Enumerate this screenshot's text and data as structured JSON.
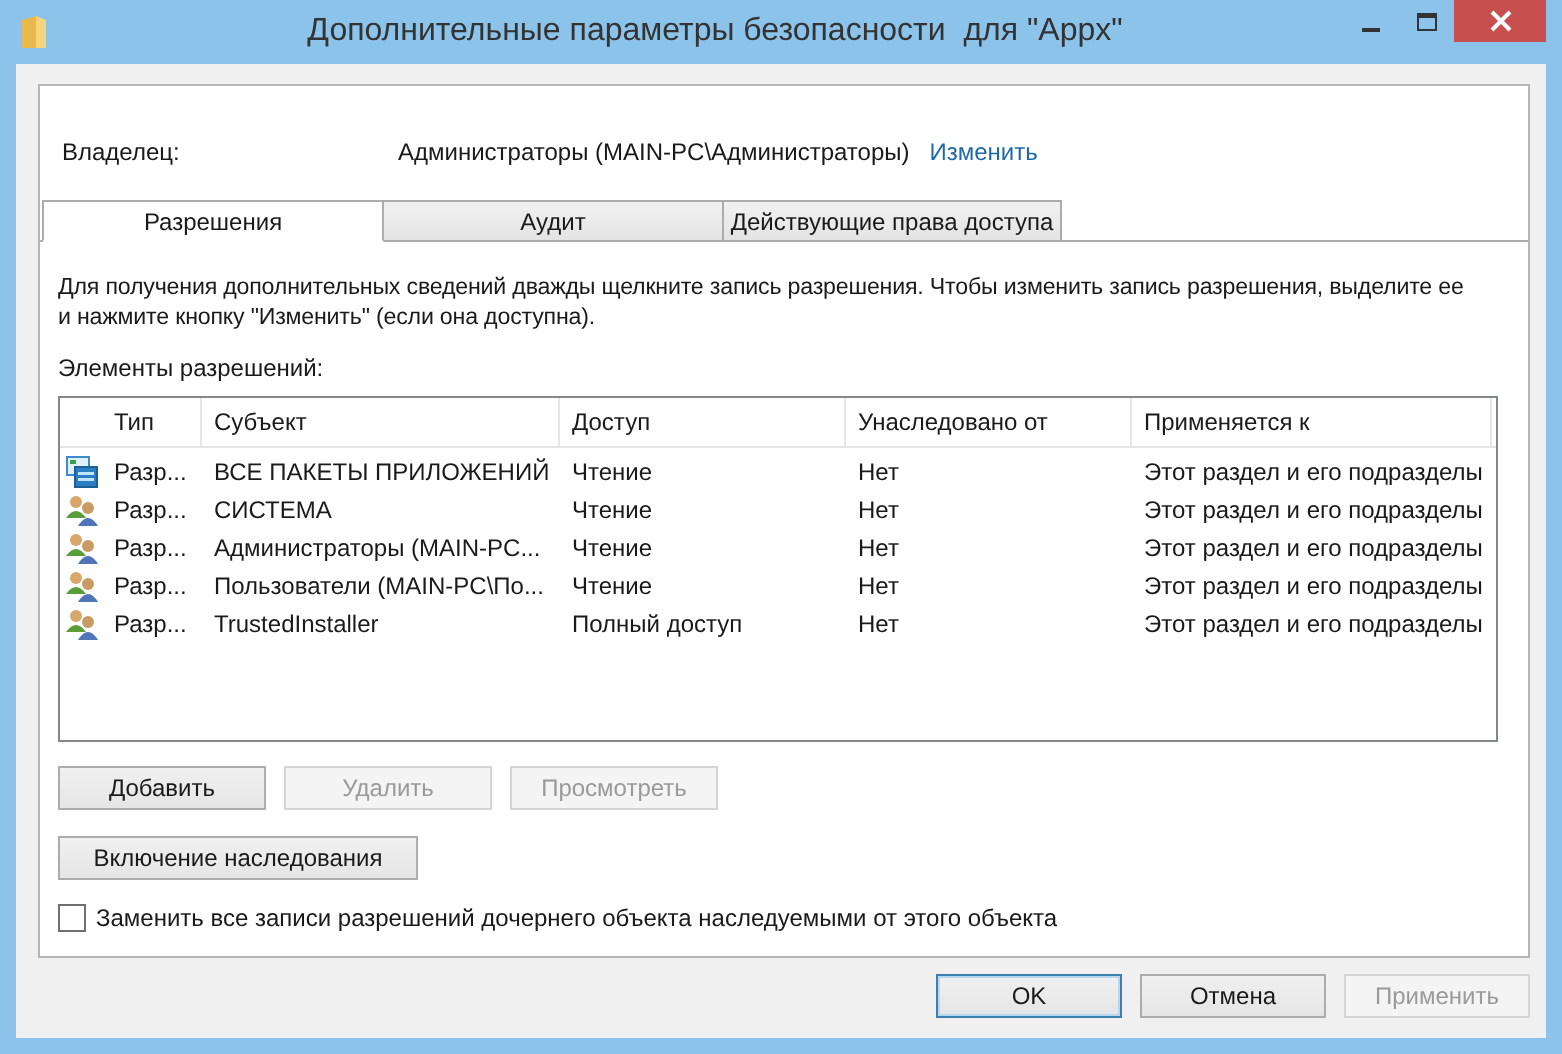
{
  "window": {
    "title": "Дополнительные параметры безопасности  для \"Appx\""
  },
  "owner": {
    "label": "Владелец:",
    "value": "Администраторы (MAIN-PC\\Администраторы)",
    "link": "Изменить"
  },
  "tabs": [
    {
      "label": "Разрешения",
      "selected": true
    },
    {
      "label": "Аудит",
      "selected": false
    },
    {
      "label": "Действующие права доступа",
      "selected": false
    }
  ],
  "description": "Для получения дополнительных сведений дважды щелкните запись разрешения. Чтобы изменить запись разрешения, выделите ее и нажмите кнопку \"Изменить\" (если она доступна).",
  "list_label": "Элементы разрешений:",
  "table": {
    "columns": [
      "Тип",
      "Субъект",
      "Доступ",
      "Унаследовано от",
      "Применяется к"
    ],
    "rows": [
      {
        "kind": "package",
        "cells": [
          "Разр...",
          "ВСЕ ПАКЕТЫ ПРИЛОЖЕНИЙ",
          "Чтение",
          "Нет",
          "Этот раздел и его подразделы"
        ]
      },
      {
        "kind": "group",
        "cells": [
          "Разр...",
          "СИСТЕМА",
          "Чтение",
          "Нет",
          "Этот раздел и его подразделы"
        ]
      },
      {
        "kind": "group",
        "cells": [
          "Разр...",
          "Администраторы (MAIN-PC...",
          "Чтение",
          "Нет",
          "Этот раздел и его подразделы"
        ]
      },
      {
        "kind": "group",
        "cells": [
          "Разр...",
          "Пользователи (MAIN-PC\\По...",
          "Чтение",
          "Нет",
          "Этот раздел и его подразделы"
        ]
      },
      {
        "kind": "group",
        "cells": [
          "Разр...",
          "TrustedInstaller",
          "Полный доступ",
          "Нет",
          "Этот раздел и его подразделы"
        ]
      }
    ]
  },
  "list_buttons": [
    {
      "label": "Добавить",
      "disabled": false
    },
    {
      "label": "Удалить",
      "disabled": true
    },
    {
      "label": "Просмотреть",
      "disabled": true
    }
  ],
  "inheritance_button": {
    "label": "Включение наследования",
    "disabled": false
  },
  "replace_checkbox": {
    "label": "Заменить все записи разрешений дочернего объекта наследуемыми от этого объекта",
    "checked": false
  },
  "dialog_buttons": [
    {
      "label": "OK",
      "disabled": false,
      "default": true
    },
    {
      "label": "Отмена",
      "disabled": false,
      "default": false
    },
    {
      "label": "Применить",
      "disabled": true,
      "default": false
    }
  ]
}
